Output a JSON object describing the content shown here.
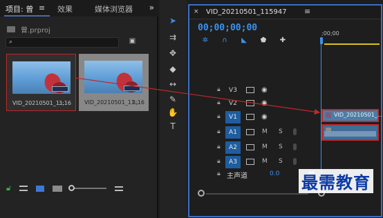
{
  "project_panel": {
    "tab_project": "项目: 曾",
    "tab_menu": "≡",
    "tab_effects": "效果",
    "tab_media_browser": "媒体浏览器",
    "more": "»",
    "project_file": "曾.prproj",
    "search_placeholder": "",
    "clips": [
      {
        "name": "VID_20210501_1...",
        "duration": "3;16"
      },
      {
        "name": "VID_20210501_11...",
        "duration": "3;16"
      }
    ]
  },
  "timeline": {
    "title": "VID_20210501_115947",
    "menu": "≡",
    "close": "×",
    "timecode": "00;00;00;00",
    "ruler_label": ";00;00",
    "video_tracks": [
      {
        "label": "V3"
      },
      {
        "label": "V2"
      },
      {
        "label": "V1"
      }
    ],
    "audio_tracks": [
      {
        "label": "A1",
        "m": "M",
        "s": "S"
      },
      {
        "label": "A2",
        "m": "M",
        "s": "S"
      },
      {
        "label": "A3",
        "m": "M",
        "s": "S"
      }
    ],
    "master": {
      "label": "主声道",
      "value": "0.0"
    },
    "video_clip_name": "VID_20210501_..."
  },
  "watermark": "最需教育",
  "colors": {
    "accent": "#3a93ef",
    "highlight_red": "#c0292a",
    "track_active": "#1e5d9f"
  }
}
